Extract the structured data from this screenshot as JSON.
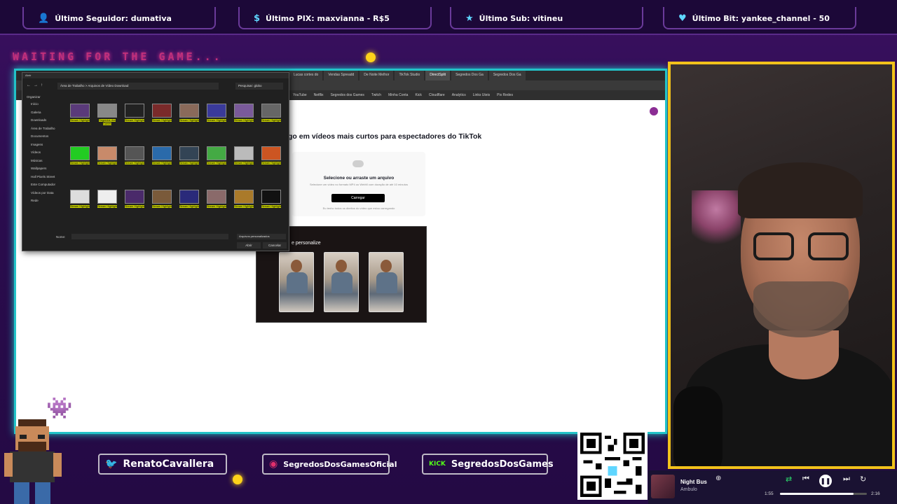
{
  "top_alerts": [
    {
      "icon": "user-icon",
      "label": "Último Seguidor: dumativa"
    },
    {
      "icon": "dollar-icon",
      "label": "Último PIX: maxvianna - R$5"
    },
    {
      "icon": "star-icon",
      "label": "Último Sub: vitineu"
    },
    {
      "icon": "heart-icon",
      "label": "Último Bit: yankee_channel - 50"
    }
  ],
  "waiting_text": "WAITING FOR THE GAME...",
  "browser": {
    "tabs": [
      "Lucas cortes do",
      "Vendas Spreadd",
      "De Noite Melhor",
      "TikTok Studio",
      "DirectSplit",
      "Segredos Dos Ga",
      "Segredos Dos Ga"
    ],
    "bookmarks": [
      "YouTube",
      "Netflix",
      "Segredos dos Games",
      "Twitch",
      "Minha Conta",
      "Kick",
      "Cloudflare",
      "Analytics",
      "Links Uteis",
      "Pix Redes"
    ],
    "page_heading": "go em vídeos mais curtos para espectadores do TikTok",
    "upload": {
      "title": "Selecione ou arraste um arquivo",
      "subtitle": "Selecione um vídeo no formato MP4 ou WebM com duração de até 10 minutos",
      "button": "Carregar",
      "note": "Eu tenho todos os direitos do vídeo que estou carregando"
    },
    "promo_title": "e personalize"
  },
  "file_dialog": {
    "title": "Abrir",
    "address": "Área de Trabalho > Arquivos de Vídeo Download",
    "search": "Pesquisar: globo",
    "organize": "Organizar",
    "sidebar": [
      "Início",
      "Galeria",
      "Downloads",
      "Área de Trabalho",
      "Documentos",
      "Imagens",
      "Vídeos",
      "Músicas",
      "Wallpapers",
      "Hall Pixels Street",
      "Este Computador",
      "Vídeos por Data",
      "Rede"
    ],
    "filename_label": "Nome:",
    "filter": "Arquivos personalizados",
    "open_button": "Abrir",
    "cancel_button": "Cancelar",
    "files": [
      "Stream Highlight",
      "Segredos dos Games",
      "Stream Highlight",
      "Stream Highlight",
      "Stream Highlight",
      "Stream Highlight",
      "Stream Highlight",
      "Stream Highlight",
      "Stream Highlight",
      "Stream Highlight",
      "Stream Highlight",
      "Stream Highlight",
      "Stream Highlight",
      "Stream Highlight",
      "Stream Highlight",
      "Stream Highlight",
      "Stream Highlight",
      "Stream Highlight",
      "Stream Highlight",
      "Stream Highlight",
      "Stream Highlight",
      "Stream Highlight",
      "Stream Highlight",
      "Stream Highlight"
    ]
  },
  "socials": [
    {
      "icon": "twitter-icon",
      "handle": "RenatoCavallera"
    },
    {
      "icon": "instagram-icon",
      "handle": "SegredosDosGamesOficial"
    },
    {
      "icon": "kick-icon",
      "badge": "KICK",
      "handle": "SegredosDosGames"
    }
  ],
  "livepix_url": "livepix.gg/segredosdosgames",
  "music": {
    "title": "Night Bus",
    "artist": "Ambulo",
    "elapsed": "1:55",
    "duration": "2:16",
    "progress": 0.85
  },
  "colors": {
    "frame": "#22c3c8",
    "cam_border": "#f2c21b",
    "background": "#2a0a4a"
  }
}
